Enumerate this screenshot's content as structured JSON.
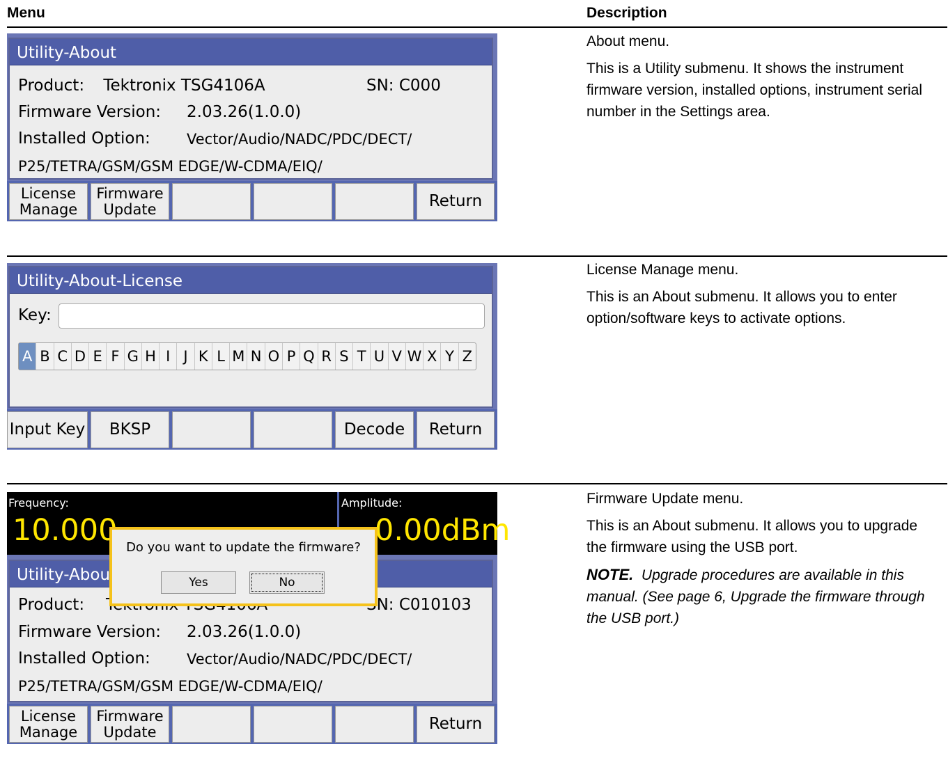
{
  "header": {
    "menu": "Menu",
    "description": "Description"
  },
  "rows": [
    {
      "screen": {
        "title": "Utility-About",
        "product_label": "Product:",
        "product_value": "Tektronix TSG4106A",
        "sn": "SN: C000",
        "fw_label": "Firmware Version:",
        "fw_value": "2.03.26(1.0.0)",
        "opt_label": "Installed Option:",
        "opt_value1": "Vector/Audio/NADC/PDC/DECT/",
        "opt_value2": "P25/TETRA/GSM/GSM EDGE/W-CDMA/EIQ/",
        "buttons": [
          "License\nManage",
          "Firmware\nUpdate",
          "",
          "",
          "",
          "Return"
        ]
      },
      "desc_title": "About menu.",
      "desc_body": "This is a Utility submenu. It shows the instrument firmware version, installed options, instrument serial number in the Settings area."
    },
    {
      "screen": {
        "title": "Utility-About-License",
        "key_label": "Key:",
        "key_value": "",
        "letters": [
          "A",
          "B",
          "C",
          "D",
          "E",
          "F",
          "G",
          "H",
          "I",
          "J",
          "K",
          "L",
          "M",
          "N",
          "O",
          "P",
          "Q",
          "R",
          "S",
          "T",
          "U",
          "V",
          "W",
          "X",
          "Y",
          "Z"
        ],
        "selected_letter": "A",
        "buttons": [
          "Input Key",
          "BKSP",
          "",
          "",
          "Decode",
          "Return"
        ]
      },
      "desc_title": "License Manage menu.",
      "desc_body": "This is an About submenu. It allows you to enter option/software keys to activate options."
    },
    {
      "screen": {
        "freq_label": "Frequency:",
        "freq_value": "10.000",
        "amp_label": "Amplitude:",
        "amp_value": "0.00dBm",
        "title": "Utility-Abou",
        "product_label": "Product:",
        "product_value": "Tektronix TSG4106A",
        "sn": "SN: C010103",
        "fw_label": "Firmware Version:",
        "fw_value": "2.03.26(1.0.0)",
        "opt_label": "Installed Option:",
        "opt_value1": "Vector/Audio/NADC/PDC/DECT/",
        "opt_value2": "P25/TETRA/GSM/GSM EDGE/W-CDMA/EIQ/",
        "dialog_question": "Do you want to update the firmware?",
        "dialog_yes": "Yes",
        "dialog_no": "No",
        "buttons": [
          "License\nManage",
          "Firmware\nUpdate",
          "",
          "",
          "",
          "Return"
        ]
      },
      "desc_title": "Firmware Update menu.",
      "desc_body": "This is an About submenu. It allows you to upgrade the firmware using the USB port.",
      "note_label": "NOTE.",
      "note_body": "Upgrade procedures are available in this manual. (See page 6, Upgrade the firmware through the USB port.)"
    }
  ]
}
